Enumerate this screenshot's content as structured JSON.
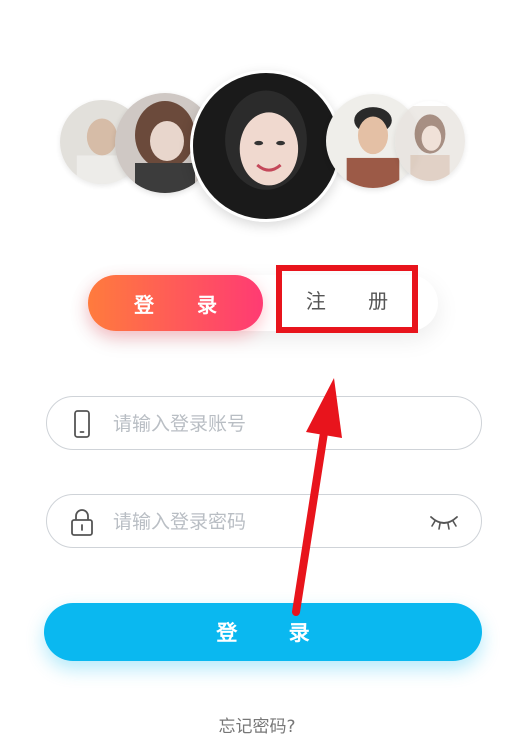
{
  "tabs": {
    "login_label": "登 录",
    "register_label": "注 册"
  },
  "form": {
    "account_placeholder": "请输入登录账号",
    "password_placeholder": "请输入登录密码"
  },
  "actions": {
    "login_label": "登 录",
    "forgot_label": "忘记密码?"
  },
  "colors": {
    "tab_gradient_start": "#ff7b3d",
    "tab_gradient_end": "#ff3b73",
    "login_button": "#0ab8f0",
    "highlight_red": "#e8141c"
  },
  "icons": {
    "account": "phone-icon",
    "password": "lock-icon",
    "visibility": "eye-closed-icon"
  }
}
